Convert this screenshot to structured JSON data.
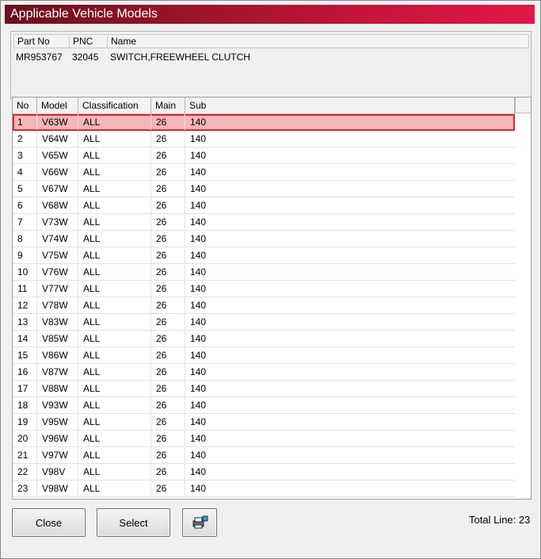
{
  "window": {
    "title": "Applicable Vehicle Models"
  },
  "part": {
    "headers": [
      "Part No",
      "PNC",
      "Name"
    ],
    "part_no": "MR953767",
    "pnc": "32045",
    "name": "SWITCH,FREEWHEEL CLUTCH"
  },
  "grid": {
    "headers": [
      "No",
      "Model",
      "Classification",
      "Main",
      "Sub"
    ],
    "selected_row": 1,
    "rows": [
      [
        "1",
        "V63W",
        "ALL",
        "26",
        "140"
      ],
      [
        "2",
        "V64W",
        "ALL",
        "26",
        "140"
      ],
      [
        "3",
        "V65W",
        "ALL",
        "26",
        "140"
      ],
      [
        "4",
        "V66W",
        "ALL",
        "26",
        "140"
      ],
      [
        "5",
        "V67W",
        "ALL",
        "26",
        "140"
      ],
      [
        "6",
        "V68W",
        "ALL",
        "26",
        "140"
      ],
      [
        "7",
        "V73W",
        "ALL",
        "26",
        "140"
      ],
      [
        "8",
        "V74W",
        "ALL",
        "26",
        "140"
      ],
      [
        "9",
        "V75W",
        "ALL",
        "26",
        "140"
      ],
      [
        "10",
        "V76W",
        "ALL",
        "26",
        "140"
      ],
      [
        "11",
        "V77W",
        "ALL",
        "26",
        "140"
      ],
      [
        "12",
        "V78W",
        "ALL",
        "26",
        "140"
      ],
      [
        "13",
        "V83W",
        "ALL",
        "26",
        "140"
      ],
      [
        "14",
        "V85W",
        "ALL",
        "26",
        "140"
      ],
      [
        "15",
        "V86W",
        "ALL",
        "26",
        "140"
      ],
      [
        "16",
        "V87W",
        "ALL",
        "26",
        "140"
      ],
      [
        "17",
        "V88W",
        "ALL",
        "26",
        "140"
      ],
      [
        "18",
        "V93W",
        "ALL",
        "26",
        "140"
      ],
      [
        "19",
        "V95W",
        "ALL",
        "26",
        "140"
      ],
      [
        "20",
        "V96W",
        "ALL",
        "26",
        "140"
      ],
      [
        "21",
        "V97W",
        "ALL",
        "26",
        "140"
      ],
      [
        "22",
        "V98V",
        "ALL",
        "26",
        "140"
      ],
      [
        "23",
        "V98W",
        "ALL",
        "26",
        "140"
      ]
    ]
  },
  "buttons": {
    "close": "Close",
    "select": "Select",
    "print_icon": "printer-icon"
  },
  "footer": {
    "total_line": "Total Line: 23"
  },
  "colors": {
    "title_start": "#6a0f1c",
    "title_end": "#e1184a",
    "selection": "#f7b6b9",
    "selection_border": "#d62830"
  }
}
